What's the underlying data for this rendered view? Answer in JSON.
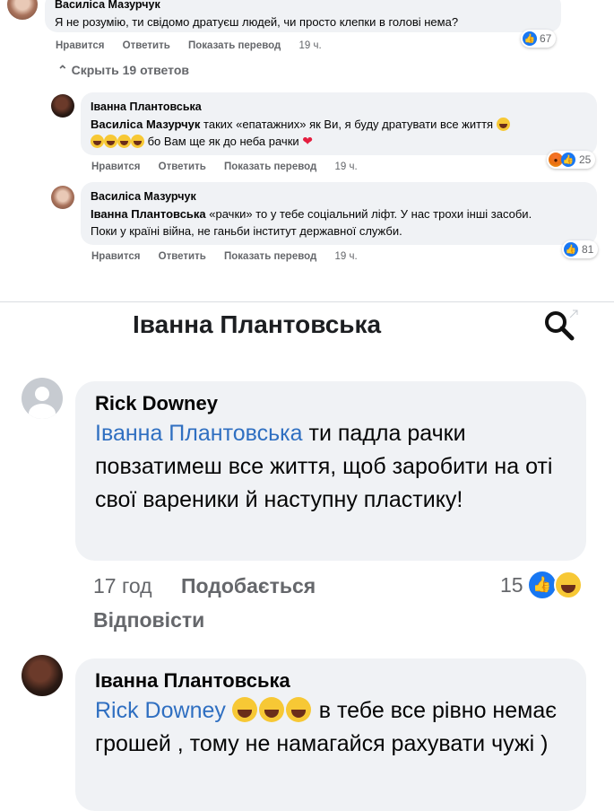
{
  "top_section": {
    "first_comment": {
      "author": "Василіса Мазурчук",
      "text": "Я не розумію, ти свідомо дратуєш людей, чи просто клепки в голові нема?",
      "actions": [
        "Нравится",
        "Ответить",
        "Показать перевод"
      ],
      "time": "19 ч.",
      "reaction_count": "67"
    },
    "hide_replies_label": "Скрыть 19 ответов",
    "reply1": {
      "author": "Іванна Плантовська",
      "tag": "Василіса Мазурчук",
      "text_part1": " таких «епатажних» як Ви, я буду дратувати все життя",
      "text_part2": " бо Вам ще як до неба рачки",
      "actions": [
        "Нравится",
        "Ответить",
        "Показать перевод"
      ],
      "time": "19 ч.",
      "reaction_count": "25"
    },
    "reply2": {
      "author": "Василіса Мазурчук",
      "tag": "Іванна Плантовська",
      "text": " «рачки» то у тебе соціальний ліфт. У нас трохи інші засоби. Поки у країні війна, не ганьби інститут державної служби.",
      "actions": [
        "Нравится",
        "Ответить",
        "Показать перевод"
      ],
      "time": "19 ч.",
      "reaction_count": "81"
    }
  },
  "bottom_section": {
    "header_title": "Іванна Плантовська",
    "comment1": {
      "author": "Rick Downey",
      "tag": "Іванна Плантовська",
      "text": " ти падла рачки повзатимеш все життя, щоб заробити на оті свої вареники й наступну пластику!",
      "time": "17 год",
      "like_label": "Подобається",
      "reply_label": "Відповісти",
      "reaction_count": "15"
    },
    "comment2": {
      "author": "Іванна Плантовська",
      "tag": "Rick Downey",
      "text": " в тебе все рівно немає грошей , тому не намагайся рахувати чужі )"
    }
  },
  "colors": {
    "link": "#2f6fc1",
    "like": "#1877f2",
    "bubble": "#f0f2f5",
    "meta": "#65676b"
  }
}
